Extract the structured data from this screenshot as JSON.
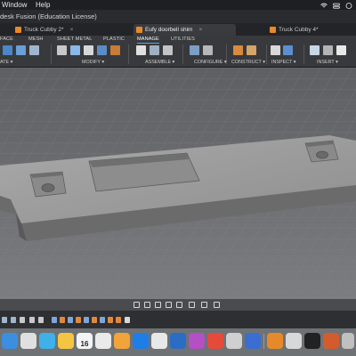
{
  "menubar": {
    "item_window": "Window",
    "item_help": "Help"
  },
  "app_title": "desk Fusion (Education License)",
  "doc_tabs": [
    {
      "label": "Truck Cubby 2*"
    },
    {
      "label": "Eufy doorbell shim"
    },
    {
      "label": "Truck Cubby 4*"
    }
  ],
  "toolbar": {
    "tabs": [
      "FACE",
      "MESH",
      "SHEET METAL",
      "PLASTIC",
      "MANAGE",
      "UTILITIES"
    ],
    "groups": [
      "ATE ▾",
      "MODIFY ▾",
      "ASSEMBLE ▾",
      "CONFIGURE ▾",
      "CONSTRUCT ▾",
      "INSPECT ▾",
      "INSERT ▾"
    ]
  },
  "dock": {
    "calendar_day": "16"
  }
}
